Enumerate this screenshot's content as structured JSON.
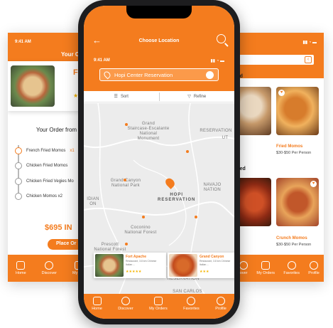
{
  "left_screen": {
    "time": "9:41 AM",
    "title": "Your O",
    "card_name": "F",
    "card_stars": "★",
    "order_title": "Your Order from",
    "items": [
      {
        "name": "French Fried Momos",
        "qty": "x1"
      },
      {
        "name": "Chicken Fried Momos",
        "qty": ""
      },
      {
        "name": "Chicken Fried Vegies Mo",
        "qty": ""
      },
      {
        "name": "Chicken Momos x2",
        "qty": ""
      }
    ],
    "price": "$695 IN",
    "place_order": "Place Or",
    "tabs": [
      "Home",
      "Discover",
      "My Ord"
    ]
  },
  "right_screen": {
    "heading_top": "red",
    "heading_mid": "ered",
    "item1_name": "Fried Momos",
    "item1_range": "$30-$50 Per Person",
    "item2_name": "Crunch Momos",
    "item2_range": "$30-$50 Per Person",
    "tabs": [
      "over",
      "My Orders",
      "Favorites",
      "Profile"
    ]
  },
  "phone": {
    "title": "Choose Location",
    "time": "9:41 AM",
    "location_value": "Hopi Center Reservation",
    "filter_sort": "Sort",
    "filter_refine": "Refine",
    "map_labels": {
      "grand_staircase": "Grand\nStaircase-Escalante\nNational\nMonument",
      "grand_canyon": "Grand Canyon\nNational Park",
      "navajo": "NAVAJO\nNATION",
      "reservation": "RESERVATION",
      "coconino": "Coconino\nNational Forest",
      "prescott": "Prescott\nNational Forest",
      "ut": "UT",
      "hopi": "HOPI\nRESERVATION",
      "indian": "IDIAN\nON",
      "forest": "Forest",
      "san_carlos": "SAN CARLOS",
      "reservation_bottom": "RESERVATION"
    },
    "cards": [
      {
        "name": "Fort Apache",
        "sub": "Restaurant, 3.8 km Chinese Italian ...",
        "stars": "★★★★★"
      },
      {
        "name": "Grand Canyon",
        "sub": "Restaurant, 3.8 km Chinese Italian ...",
        "stars": "★★★"
      }
    ],
    "tabs": [
      "Home",
      "Discover",
      "My Orders",
      "Favorites",
      "Profile"
    ]
  },
  "colors": {
    "accent": "#f47c1e",
    "star": "#f5b400"
  }
}
